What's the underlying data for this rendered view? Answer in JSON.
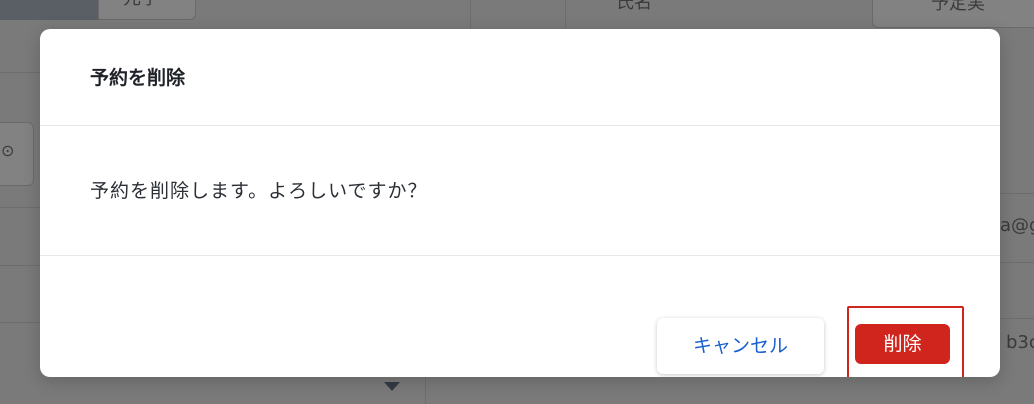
{
  "background": {
    "column_header_name": "氏名",
    "header_button": "予定実",
    "tab_active": "",
    "tab_inactive": "元予",
    "email_fragment": "a@g",
    "id_fragment": "b3c"
  },
  "dialog": {
    "title": "予約を削除",
    "message": "予約を削除します。よろしいですか？",
    "cancel_label": "キャンセル",
    "delete_label": "削除"
  },
  "colors": {
    "danger": "#d0251d",
    "link_blue": "#1a5fd0",
    "overlay": "#7a7a7a"
  }
}
